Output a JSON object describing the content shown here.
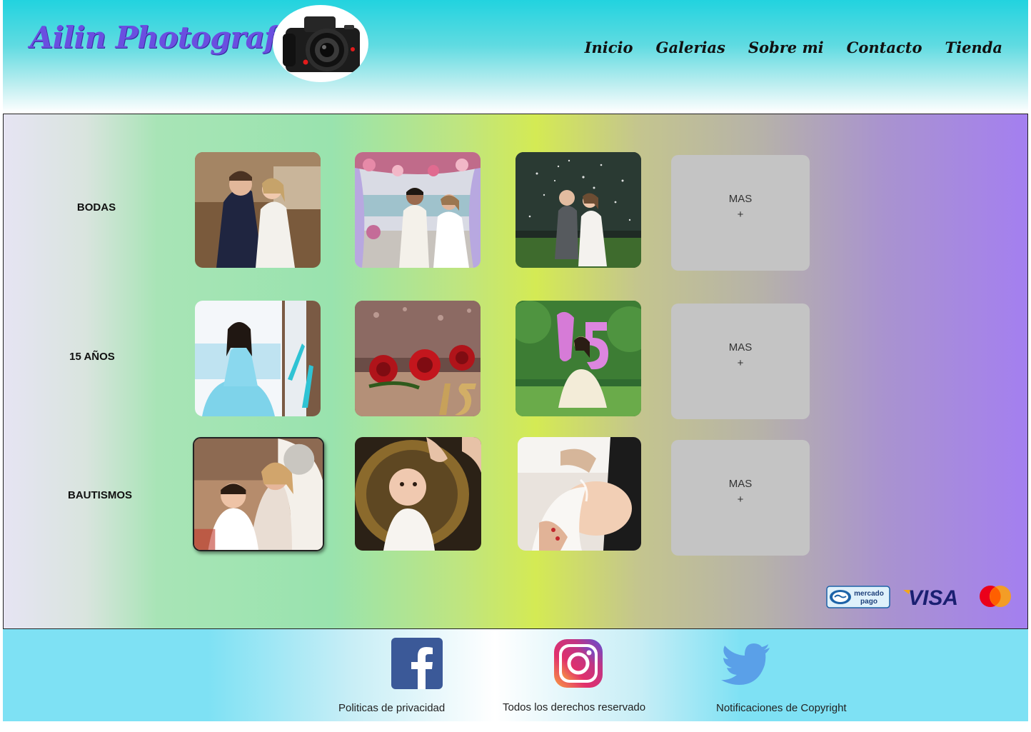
{
  "header": {
    "brand": "Ailin Photografh",
    "nav": [
      "Inicio",
      "Galerias",
      "Sobre mi",
      "Contacto",
      "Tienda"
    ]
  },
  "categories": [
    {
      "label": "BODAS",
      "more_label": "MAS",
      "more_symbol": "+"
    },
    {
      "label": "15 AÑOS",
      "more_label": "MAS",
      "more_symbol": "+"
    },
    {
      "label": "BAUTISMOS",
      "more_label": "MAS",
      "more_symbol": "+"
    }
  ],
  "payments": {
    "mercadopago": {
      "line1": "mercado",
      "line2": "pago"
    },
    "visa": "VISA"
  },
  "footer": {
    "links": [
      "Politicas de privacidad",
      "Todos los derechos reservado",
      "Notificaciones de Copyright"
    ]
  },
  "colors": {
    "brand": "#6a4fe0",
    "header_top": "#22d3df",
    "tile_gray": "#c4c4c4",
    "footer": "#7ee1f4",
    "facebook": "#3b5998",
    "twitter": "#5aa0e8"
  }
}
